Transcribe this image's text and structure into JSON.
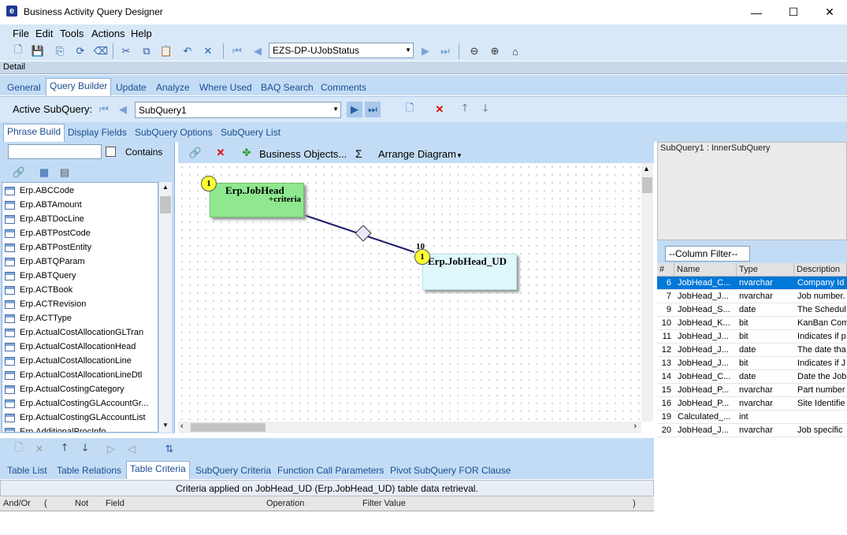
{
  "window": {
    "title": "Business Activity Query Designer",
    "minimize": "—",
    "maximize": "☐",
    "close": "✕"
  },
  "menu": [
    "File",
    "Edit",
    "Tools",
    "Actions",
    "Help"
  ],
  "toolbar": {
    "query_combo": "EZS-DP-UJobStatus"
  },
  "detail_label": "Detail",
  "main_tabs": [
    "General",
    "Query Builder",
    "Update",
    "Analyze",
    "Where Used",
    "BAQ Search",
    "Comments"
  ],
  "active_main_tab": "Query Builder",
  "subquery": {
    "label": "Active SubQuery:",
    "value": "SubQuery1"
  },
  "sub_tabs": [
    "Phrase Build",
    "Display Fields",
    "SubQuery Options",
    "SubQuery List"
  ],
  "left": {
    "contains_label": "Contains",
    "search_value": ""
  },
  "tables": [
    "Erp.ABCCode",
    "Erp.ABTAmount",
    "Erp.ABTDocLine",
    "Erp.ABTPostCode",
    "Erp.ABTPostEntity",
    "Erp.ABTQParam",
    "Erp.ABTQuery",
    "Erp.ACTBook",
    "Erp.ACTRevision",
    "Erp.ACTType",
    "Erp.ActualCostAllocationGLTran",
    "Erp.ActualCostAllocationHead",
    "Erp.ActualCostAllocationLine",
    "Erp.ActualCostAllocationLineDtl",
    "Erp.ActualCostingCategory",
    "Erp.ActualCostingGLAccountGr...",
    "Erp.ActualCostingGLAccountList",
    "Erp.AdditionalProcInfo"
  ],
  "diagram_toolbar": {
    "business_objects": "Business Objects...",
    "sigma": "Σ",
    "arrange": "Arrange Diagram"
  },
  "nodes": [
    {
      "badge": "1",
      "title": "Erp.JobHead",
      "sub": "+criteria"
    },
    {
      "badge": "1",
      "badge_top": "10",
      "title": "Erp.JobHead_UD"
    }
  ],
  "right_top_text": "SubQuery1 : InnerSubQuery",
  "column_filter": "--Column Filter--",
  "grid_headers": [
    "#",
    "Name",
    "Type",
    "Description"
  ],
  "grid_rows": [
    [
      "6",
      "JobHead_C...",
      "nvarchar",
      "Company Id"
    ],
    [
      "7",
      "JobHead_J...",
      "nvarchar",
      "Job number."
    ],
    [
      "9",
      "JobHead_S...",
      "date",
      "The Schedul"
    ],
    [
      "10",
      "JobHead_K...",
      "bit",
      "KanBan Com"
    ],
    [
      "11",
      "JobHead_J...",
      "bit",
      "Indicates if p"
    ],
    [
      "12",
      "JobHead_J...",
      "date",
      "The date tha"
    ],
    [
      "13",
      "JobHead_J...",
      "bit",
      "Indicates if J"
    ],
    [
      "14",
      "JobHead_C...",
      "date",
      "Date the Job"
    ],
    [
      "15",
      "JobHead_P...",
      "nvarchar",
      "Part number"
    ],
    [
      "16",
      "JobHead_P...",
      "nvarchar",
      "Site Identifie"
    ],
    [
      "19",
      "Calculated_...",
      "int",
      ""
    ],
    [
      "20",
      "JobHead_J...",
      "nvarchar",
      "Job specific"
    ]
  ],
  "bottom_tabs": [
    "Table List",
    "Table Relations",
    "Table Criteria",
    "SubQuery Criteria",
    "Function Call Parameters",
    "Pivot SubQuery FOR Clause"
  ],
  "active_bottom_tab": "Table Criteria",
  "criteria_caption": "Criteria applied on JobHead_UD (Erp.JobHead_UD) table data retrieval.",
  "criteria_headers": [
    "And/Or",
    "(",
    "Not",
    "Field",
    "Operation",
    "Filter Value",
    ")"
  ]
}
